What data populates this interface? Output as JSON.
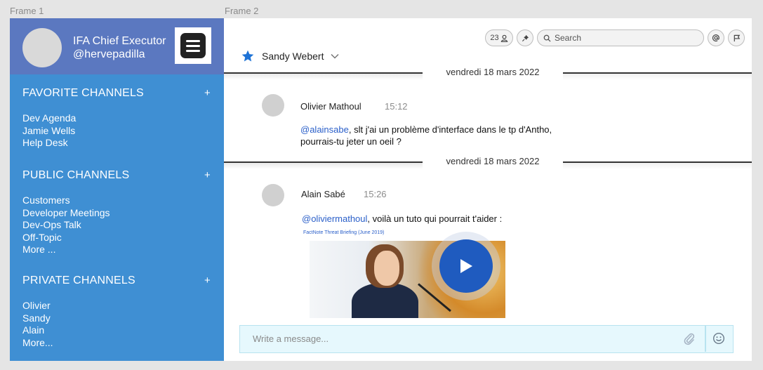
{
  "frames": {
    "frame1_label": "Frame 1",
    "frame2_label": "Frame 2"
  },
  "sidebar": {
    "user_title": "IFA Chief Executor",
    "user_handle": "@hervepadilla",
    "sections": [
      {
        "title": "FAVORITE CHANNELS",
        "add": "+",
        "items": [
          "Dev Agenda",
          "Jamie Wells",
          "Help Desk"
        ]
      },
      {
        "title": "PUBLIC CHANNELS",
        "add": "+",
        "items": [
          "Customers",
          "Developer Meetings",
          "Dev-Ops Talk",
          "Off-Topic",
          "More ..."
        ]
      },
      {
        "title": "PRIVATE CHANNELS",
        "add": "+",
        "items": [
          "Olivier",
          "Sandy",
          "Alain",
          "More..."
        ]
      }
    ]
  },
  "toolbar": {
    "member_count": "23",
    "search_placeholder": "Search"
  },
  "conversation": {
    "title": "Sandy Webert"
  },
  "messages": [
    {
      "date": "vendredi 18 mars 2022",
      "author": "Olivier Mathoul",
      "time": "15:12",
      "mention": "@alainsabe",
      "text_line1": ", slt j'ai un problème d'interface dans le tp d'Antho,",
      "text_line2": "pourrais-tu jeter un oeil ?"
    },
    {
      "date": "vendredi 18 mars 2022",
      "author": "Alain Sabé",
      "time": "15:26",
      "mention": "@oliviermathoul",
      "text_line1": ", voilà un tuto qui pourrait t'aider :",
      "media_caption": "FactNote Threat Briefing (June 2019)"
    }
  ],
  "composer": {
    "placeholder": "Write a message..."
  },
  "colors": {
    "sidebar_bg": "#3f8fd3",
    "sidebar_header_bg": "#5b78c0",
    "mention": "#2a5fc9",
    "play_button": "#1f5bbf",
    "composer_bg": "#e6f8fd"
  }
}
